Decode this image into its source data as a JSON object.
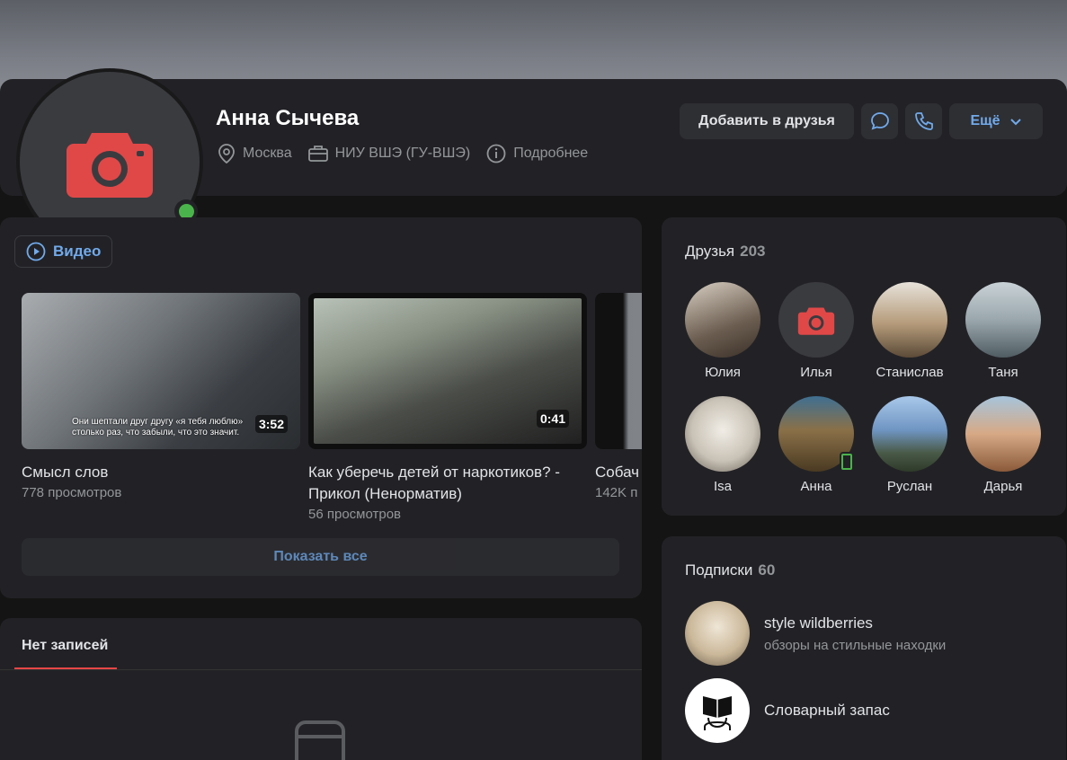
{
  "profile": {
    "name": "Анна Сычева",
    "city": "Москва",
    "university": "НИУ ВШЭ (ГУ-ВШЭ)",
    "details_label": "Подробнее",
    "add_friend_label": "Добавить в друзья",
    "more_label": "Ещё",
    "online": true
  },
  "video": {
    "section_label": "Видео",
    "items": [
      {
        "title": "Смысл слов",
        "views": "778 просмотров",
        "duration": "3:52",
        "overlay_text_1": "Они шептали друг другу «я тебя люблю»",
        "overlay_text_2": "столько раз, что забыли, что это значит."
      },
      {
        "title": "Как уберечь детей от наркотиков? - Прикол (Ненорматив)",
        "views": "56 просмотров",
        "duration": "0:41"
      },
      {
        "title": "Собач",
        "views": "142K п"
      }
    ],
    "show_all_label": "Показать все"
  },
  "posts": {
    "tab_label": "Нет записей"
  },
  "friends": {
    "title": "Друзья",
    "count": "203",
    "items": [
      {
        "name": "Юлия",
        "color": "#8a7f73"
      },
      {
        "name": "Илья",
        "color": "#3a3b3f"
      },
      {
        "name": "Станислав",
        "color": "#b59b7a"
      },
      {
        "name": "Таня",
        "color": "#9aa7ad"
      },
      {
        "name": "Isa",
        "color": "#c9c2b6"
      },
      {
        "name": "Анна",
        "color": "#6d5a3c"
      },
      {
        "name": "Руслан",
        "color": "#6f95c2"
      },
      {
        "name": "Дарья",
        "color": "#c98f5e"
      }
    ]
  },
  "subscriptions": {
    "title": "Подписки",
    "count": "60",
    "items": [
      {
        "name": "style wildberries",
        "desc": "обзоры на стильные находки"
      },
      {
        "name": "Словарный запас",
        "desc": ""
      }
    ]
  },
  "colors": {
    "accent": "#71aaeb",
    "camera_red": "#e04848",
    "online_green": "#4bb34b"
  }
}
